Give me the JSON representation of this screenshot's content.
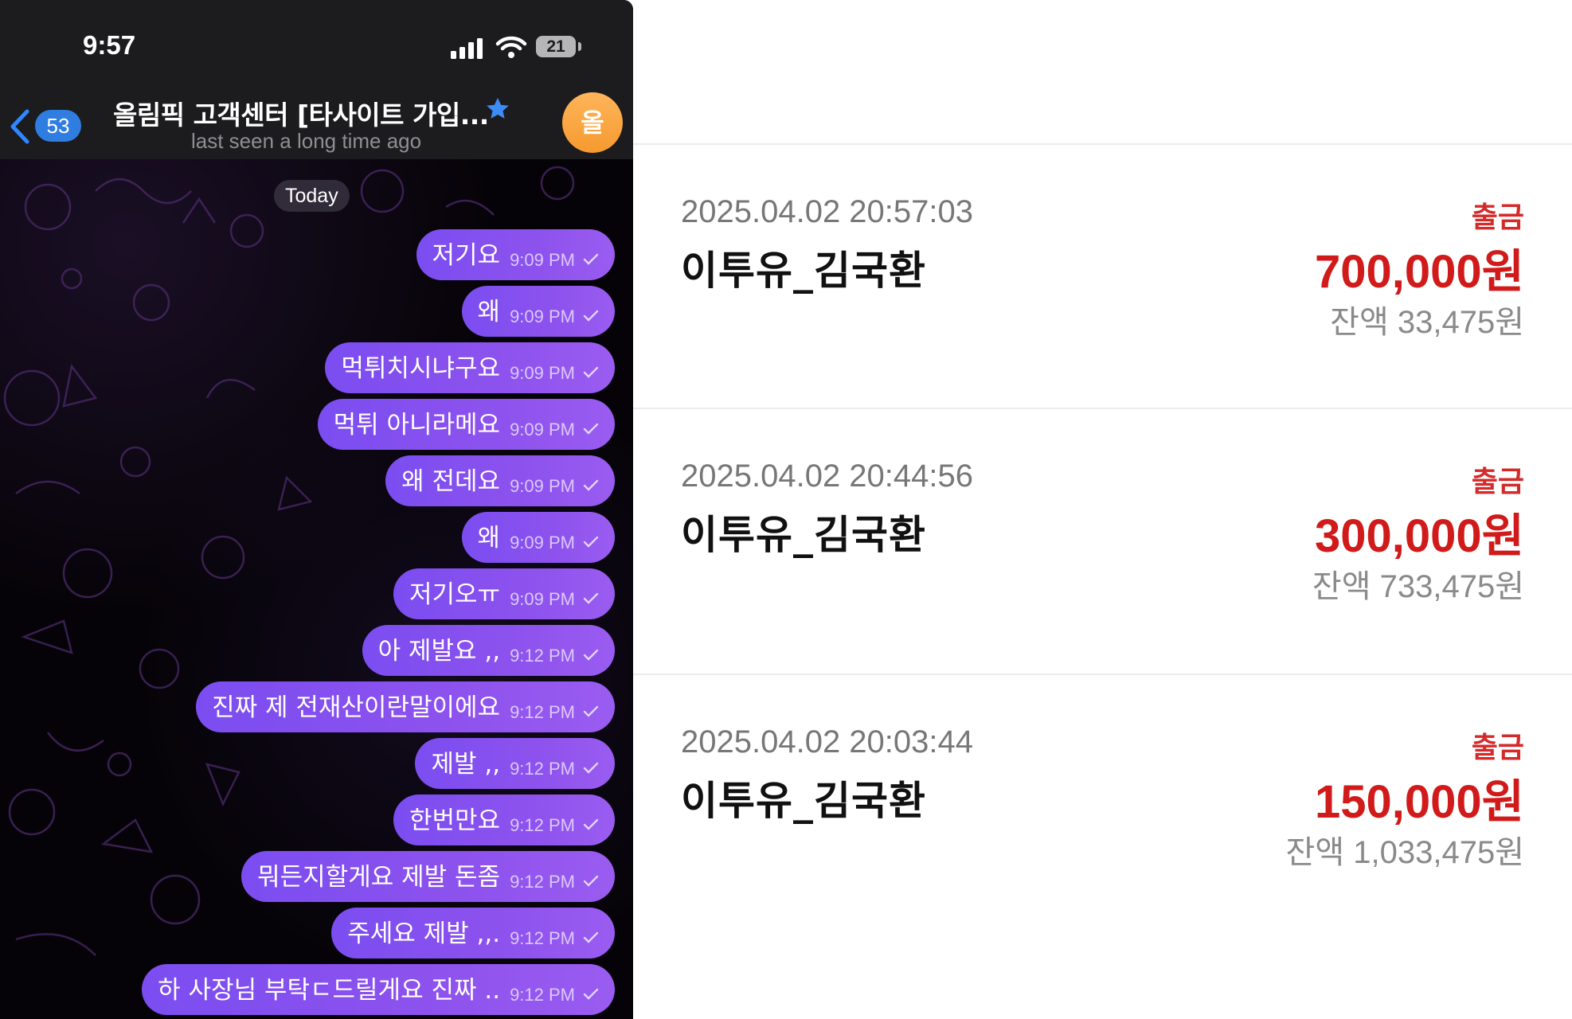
{
  "chat": {
    "status_bar": {
      "time": "9:57",
      "battery_level": "21"
    },
    "header": {
      "back_count": "53",
      "title": "올림픽 고객센터 [타사이트 가입...",
      "subtitle": "last seen a long time ago",
      "avatar_initial": "올"
    },
    "date_separator": "Today",
    "messages": [
      {
        "text": "저기요",
        "time": "9:09 PM"
      },
      {
        "text": "왜",
        "time": "9:09 PM"
      },
      {
        "text": "먹튀치시냐구요",
        "time": "9:09 PM"
      },
      {
        "text": "먹튀 아니라메요",
        "time": "9:09 PM"
      },
      {
        "text": "왜 전데요",
        "time": "9:09 PM"
      },
      {
        "text": "왜",
        "time": "9:09 PM"
      },
      {
        "text": "저기오ㅠ",
        "time": "9:09 PM"
      },
      {
        "text": "아 제발요 ,,",
        "time": "9:12 PM"
      },
      {
        "text": "진짜 제 전재산이란말이에요",
        "time": "9:12 PM"
      },
      {
        "text": "제발 ,,",
        "time": "9:12 PM"
      },
      {
        "text": "한번만요",
        "time": "9:12 PM"
      },
      {
        "text": "뭐든지할게요 제발 돈좀",
        "time": "9:12 PM"
      },
      {
        "text": "주세요 제발 ,,.",
        "time": "9:12 PM"
      },
      {
        "text": "하 사장님 부탁ㄷ드릴게요 진짜 ..",
        "time": "9:12 PM"
      }
    ],
    "colors": {
      "bubble": "#8a52ee",
      "header_bg": "#1c1c1e",
      "badge": "#2f7de0",
      "avatar": "#f7a640"
    }
  },
  "transactions": [
    {
      "datetime": "2025.04.02 20:57:03",
      "name": "이투유_김국환",
      "type": "출금",
      "amount": "700,000원",
      "balance": "잔액 33,475원"
    },
    {
      "datetime": "2025.04.02 20:44:56",
      "name": "이투유_김국환",
      "type": "출금",
      "amount": "300,000원",
      "balance": "잔액 733,475원"
    },
    {
      "datetime": "2025.04.02 20:03:44",
      "name": "이투유_김국환",
      "type": "출금",
      "amount": "150,000원",
      "balance": "잔액 1,033,475원"
    }
  ],
  "ledger_colors": {
    "withdrawal": "#d11a1a",
    "balance_text": "#8a8a8a"
  }
}
